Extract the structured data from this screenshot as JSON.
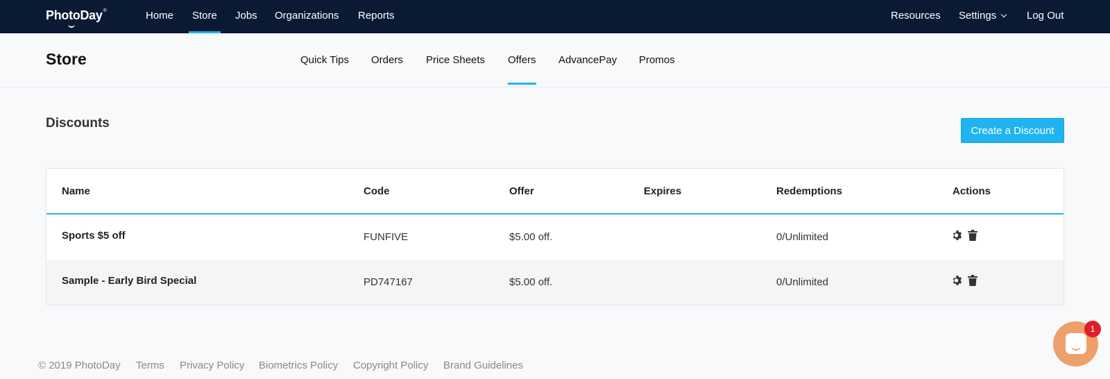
{
  "topnav": {
    "logo": "PhotoDay",
    "logo_tm": "®",
    "links": [
      {
        "label": "Home"
      },
      {
        "label": "Store"
      },
      {
        "label": "Jobs"
      },
      {
        "label": "Organizations"
      },
      {
        "label": "Reports"
      }
    ],
    "active": "Store",
    "right": {
      "resources": "Resources",
      "settings": "Settings",
      "logout": "Log Out"
    }
  },
  "subheader": {
    "title": "Store",
    "tabs": [
      {
        "label": "Quick Tips"
      },
      {
        "label": "Orders"
      },
      {
        "label": "Price Sheets"
      },
      {
        "label": "Offers"
      },
      {
        "label": "AdvancePay"
      },
      {
        "label": "Promos"
      }
    ],
    "active": "Offers"
  },
  "discounts": {
    "title": "Discounts",
    "create_button": "Create a Discount",
    "columns": [
      "Name",
      "Code",
      "Offer",
      "Expires",
      "Redemptions",
      "Actions"
    ],
    "rows": [
      {
        "name": "Sports $5 off",
        "code": "FUNFIVE",
        "offer": "$5.00 off.",
        "expires": "",
        "redemptions": "0/Unlimited"
      },
      {
        "name": "Sample - Early Bird Special",
        "code": "PD747167",
        "offer": "$5.00 off.",
        "expires": "",
        "redemptions": "0/Unlimited"
      }
    ],
    "row_actions": [
      "gear-icon",
      "trash-icon"
    ]
  },
  "footer": {
    "copyright": "© 2019 PhotoDay",
    "links": [
      "Terms",
      "Privacy Policy",
      "Biometrics Policy",
      "Copyright Policy",
      "Brand Guidelines"
    ]
  },
  "chat": {
    "badge_count": "1"
  },
  "colors": {
    "nav_bg": "#0b1a33",
    "accent": "#1fb4f0",
    "chat": "#eea06a",
    "badge": "#e01e2b"
  }
}
